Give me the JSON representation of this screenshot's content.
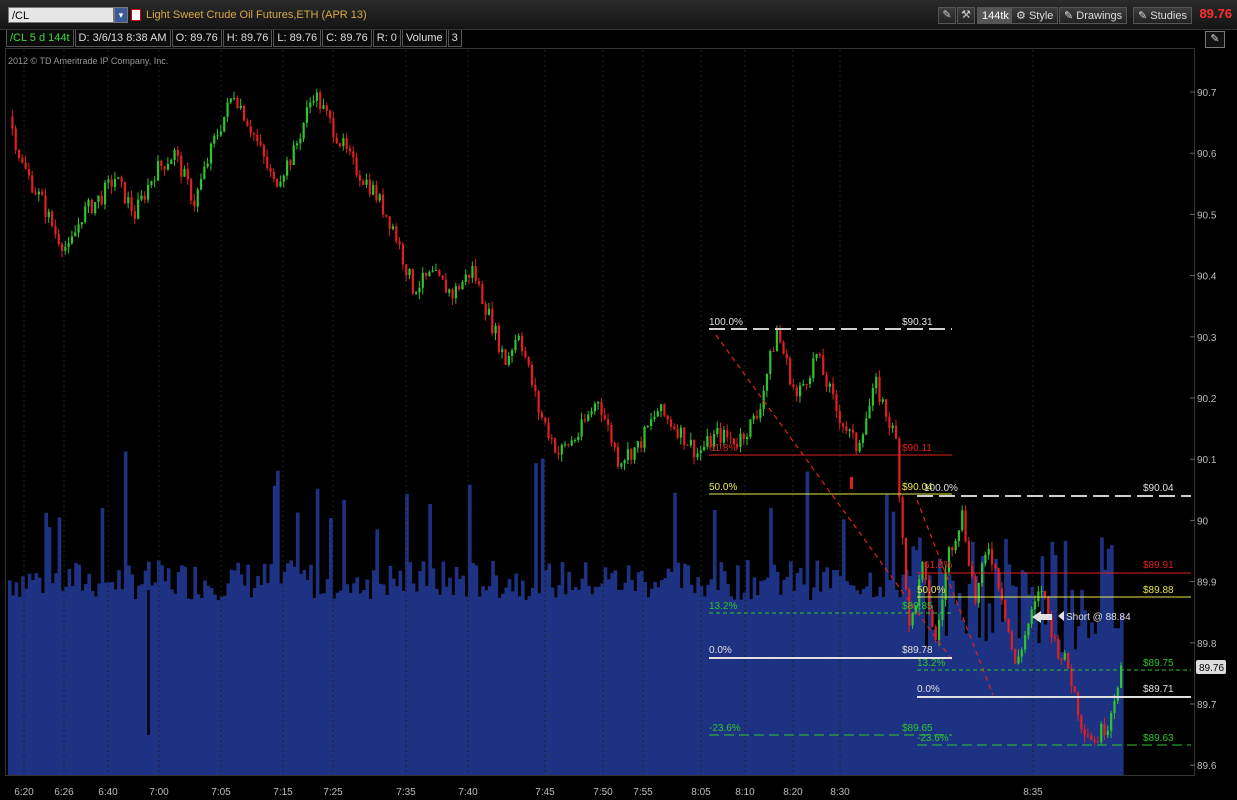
{
  "header": {
    "symbol": "/CL",
    "description": "Light Sweet Crude Oil Futures,ETH (APR 13)",
    "ticks_button": "144tk",
    "style_label": "Style",
    "drawings_label": "Drawings",
    "studies_label": "Studies",
    "last_price": "89.76"
  },
  "infobar": {
    "symbol": "/CL 5 d 144t",
    "date": "D: 3/6/13 8:38 AM",
    "open": "O: 89.76",
    "high": "H: 89.76",
    "low": "L: 89.76",
    "close": "C: 89.76",
    "range": "R: 0",
    "volume_label": "Volume",
    "volume_value": "3"
  },
  "copyright": "2012 © TD Ameritrade IP Company, Inc.",
  "colors": {
    "up_candle": "#2ec42e",
    "down_candle": "#e01f1f",
    "volume": "#1e3284",
    "fib_100": "#cfcfcf",
    "fib_618": "#e02020",
    "fib_50": "#e8e84a",
    "fib_132": "#2ec42e",
    "fib_0": "#e0e0e0"
  },
  "chart_data": {
    "type": "candlestick",
    "title": "",
    "y_axis_ticks": [
      "90.7",
      "90.6",
      "90.5",
      "90.4",
      "90.3",
      "90.2",
      "90.1",
      "90",
      "89.9",
      "89.8",
      "89.7",
      "89.6"
    ],
    "ylim": [
      89.585,
      90.77
    ],
    "x_axis_ticks": [
      "6:20",
      "6:26",
      "6:40",
      "7:00",
      "7:05",
      "7:15",
      "7:25",
      "7:35",
      "7:40",
      "7:45",
      "7:50",
      "7:55",
      "8:05",
      "8:10",
      "8:20",
      "8:30",
      "8:35"
    ],
    "price_path": [
      {
        "i": 0,
        "p": 90.66
      },
      {
        "i": 4,
        "p": 90.58
      },
      {
        "i": 10,
        "p": 90.52
      },
      {
        "i": 14,
        "p": 90.47
      },
      {
        "i": 18,
        "p": 90.44
      },
      {
        "i": 22,
        "p": 90.5
      },
      {
        "i": 28,
        "p": 90.53
      },
      {
        "i": 32,
        "p": 90.56
      },
      {
        "i": 38,
        "p": 90.5
      },
      {
        "i": 44,
        "p": 90.57
      },
      {
        "i": 50,
        "p": 90.6
      },
      {
        "i": 56,
        "p": 90.52
      },
      {
        "i": 62,
        "p": 90.62
      },
      {
        "i": 68,
        "p": 90.7
      },
      {
        "i": 74,
        "p": 90.63
      },
      {
        "i": 80,
        "p": 90.55
      },
      {
        "i": 86,
        "p": 90.6
      },
      {
        "i": 92,
        "p": 90.7
      },
      {
        "i": 98,
        "p": 90.64
      },
      {
        "i": 104,
        "p": 90.58
      },
      {
        "i": 110,
        "p": 90.54
      },
      {
        "i": 116,
        "p": 90.48
      },
      {
        "i": 122,
        "p": 90.38
      },
      {
        "i": 128,
        "p": 90.4
      },
      {
        "i": 134,
        "p": 90.37
      },
      {
        "i": 140,
        "p": 90.41
      },
      {
        "i": 146,
        "p": 90.32
      },
      {
        "i": 150,
        "p": 90.26
      },
      {
        "i": 154,
        "p": 90.31
      },
      {
        "i": 160,
        "p": 90.18
      },
      {
        "i": 166,
        "p": 90.11
      },
      {
        "i": 172,
        "p": 90.14
      },
      {
        "i": 178,
        "p": 90.2
      },
      {
        "i": 184,
        "p": 90.1
      },
      {
        "i": 190,
        "p": 90.12
      },
      {
        "i": 196,
        "p": 90.18
      },
      {
        "i": 202,
        "p": 90.15
      },
      {
        "i": 208,
        "p": 90.11
      },
      {
        "i": 214,
        "p": 90.14
      },
      {
        "i": 220,
        "p": 90.13
      },
      {
        "i": 226,
        "p": 90.17
      },
      {
        "i": 232,
        "p": 90.31
      },
      {
        "i": 238,
        "p": 90.2
      },
      {
        "i": 244,
        "p": 90.27
      },
      {
        "i": 250,
        "p": 90.18
      },
      {
        "i": 256,
        "p": 90.12
      },
      {
        "i": 262,
        "p": 90.22
      },
      {
        "i": 268,
        "p": 90.13
      },
      {
        "i": 272,
        "p": 89.82
      },
      {
        "i": 276,
        "p": 89.92
      },
      {
        "i": 280,
        "p": 89.8
      },
      {
        "i": 284,
        "p": 89.95
      },
      {
        "i": 288,
        "p": 90.01
      },
      {
        "i": 292,
        "p": 89.87
      },
      {
        "i": 296,
        "p": 89.96
      },
      {
        "i": 300,
        "p": 89.88
      },
      {
        "i": 304,
        "p": 89.76
      },
      {
        "i": 308,
        "p": 89.83
      },
      {
        "i": 312,
        "p": 89.89
      },
      {
        "i": 316,
        "p": 89.8
      },
      {
        "i": 320,
        "p": 89.76
      },
      {
        "i": 324,
        "p": 89.67
      },
      {
        "i": 328,
        "p": 89.64
      },
      {
        "i": 332,
        "p": 89.67
      },
      {
        "i": 336,
        "p": 89.76
      }
    ],
    "annotations": {
      "fib1": {
        "level_100": "100.0%",
        "price_100": "$90.31",
        "level_618": "61.8%",
        "price_618": "$90.11",
        "level_50": "50.0%",
        "price_50": "$90.04",
        "level_132": "13.2%",
        "price_132": "$89.85",
        "level_0": "0.0%",
        "price_0": "$89.78",
        "level_neg236": "-23.6%",
        "price_neg236": "$89.65"
      },
      "fib2": {
        "level_100": "100.0%",
        "price_100": "$90.04",
        "level_618": "61.8%",
        "price_618": "$89.91",
        "level_50": "50.0%",
        "price_50": "$89.88",
        "level_132": "13.2%",
        "price_132": "$89.75",
        "level_0": "0.0%",
        "price_0": "$89.71",
        "level_neg236": "-23.6%",
        "price_neg236": "$89.63"
      },
      "short_note": "Short @ 88.84",
      "price_badge": "89.76"
    }
  }
}
